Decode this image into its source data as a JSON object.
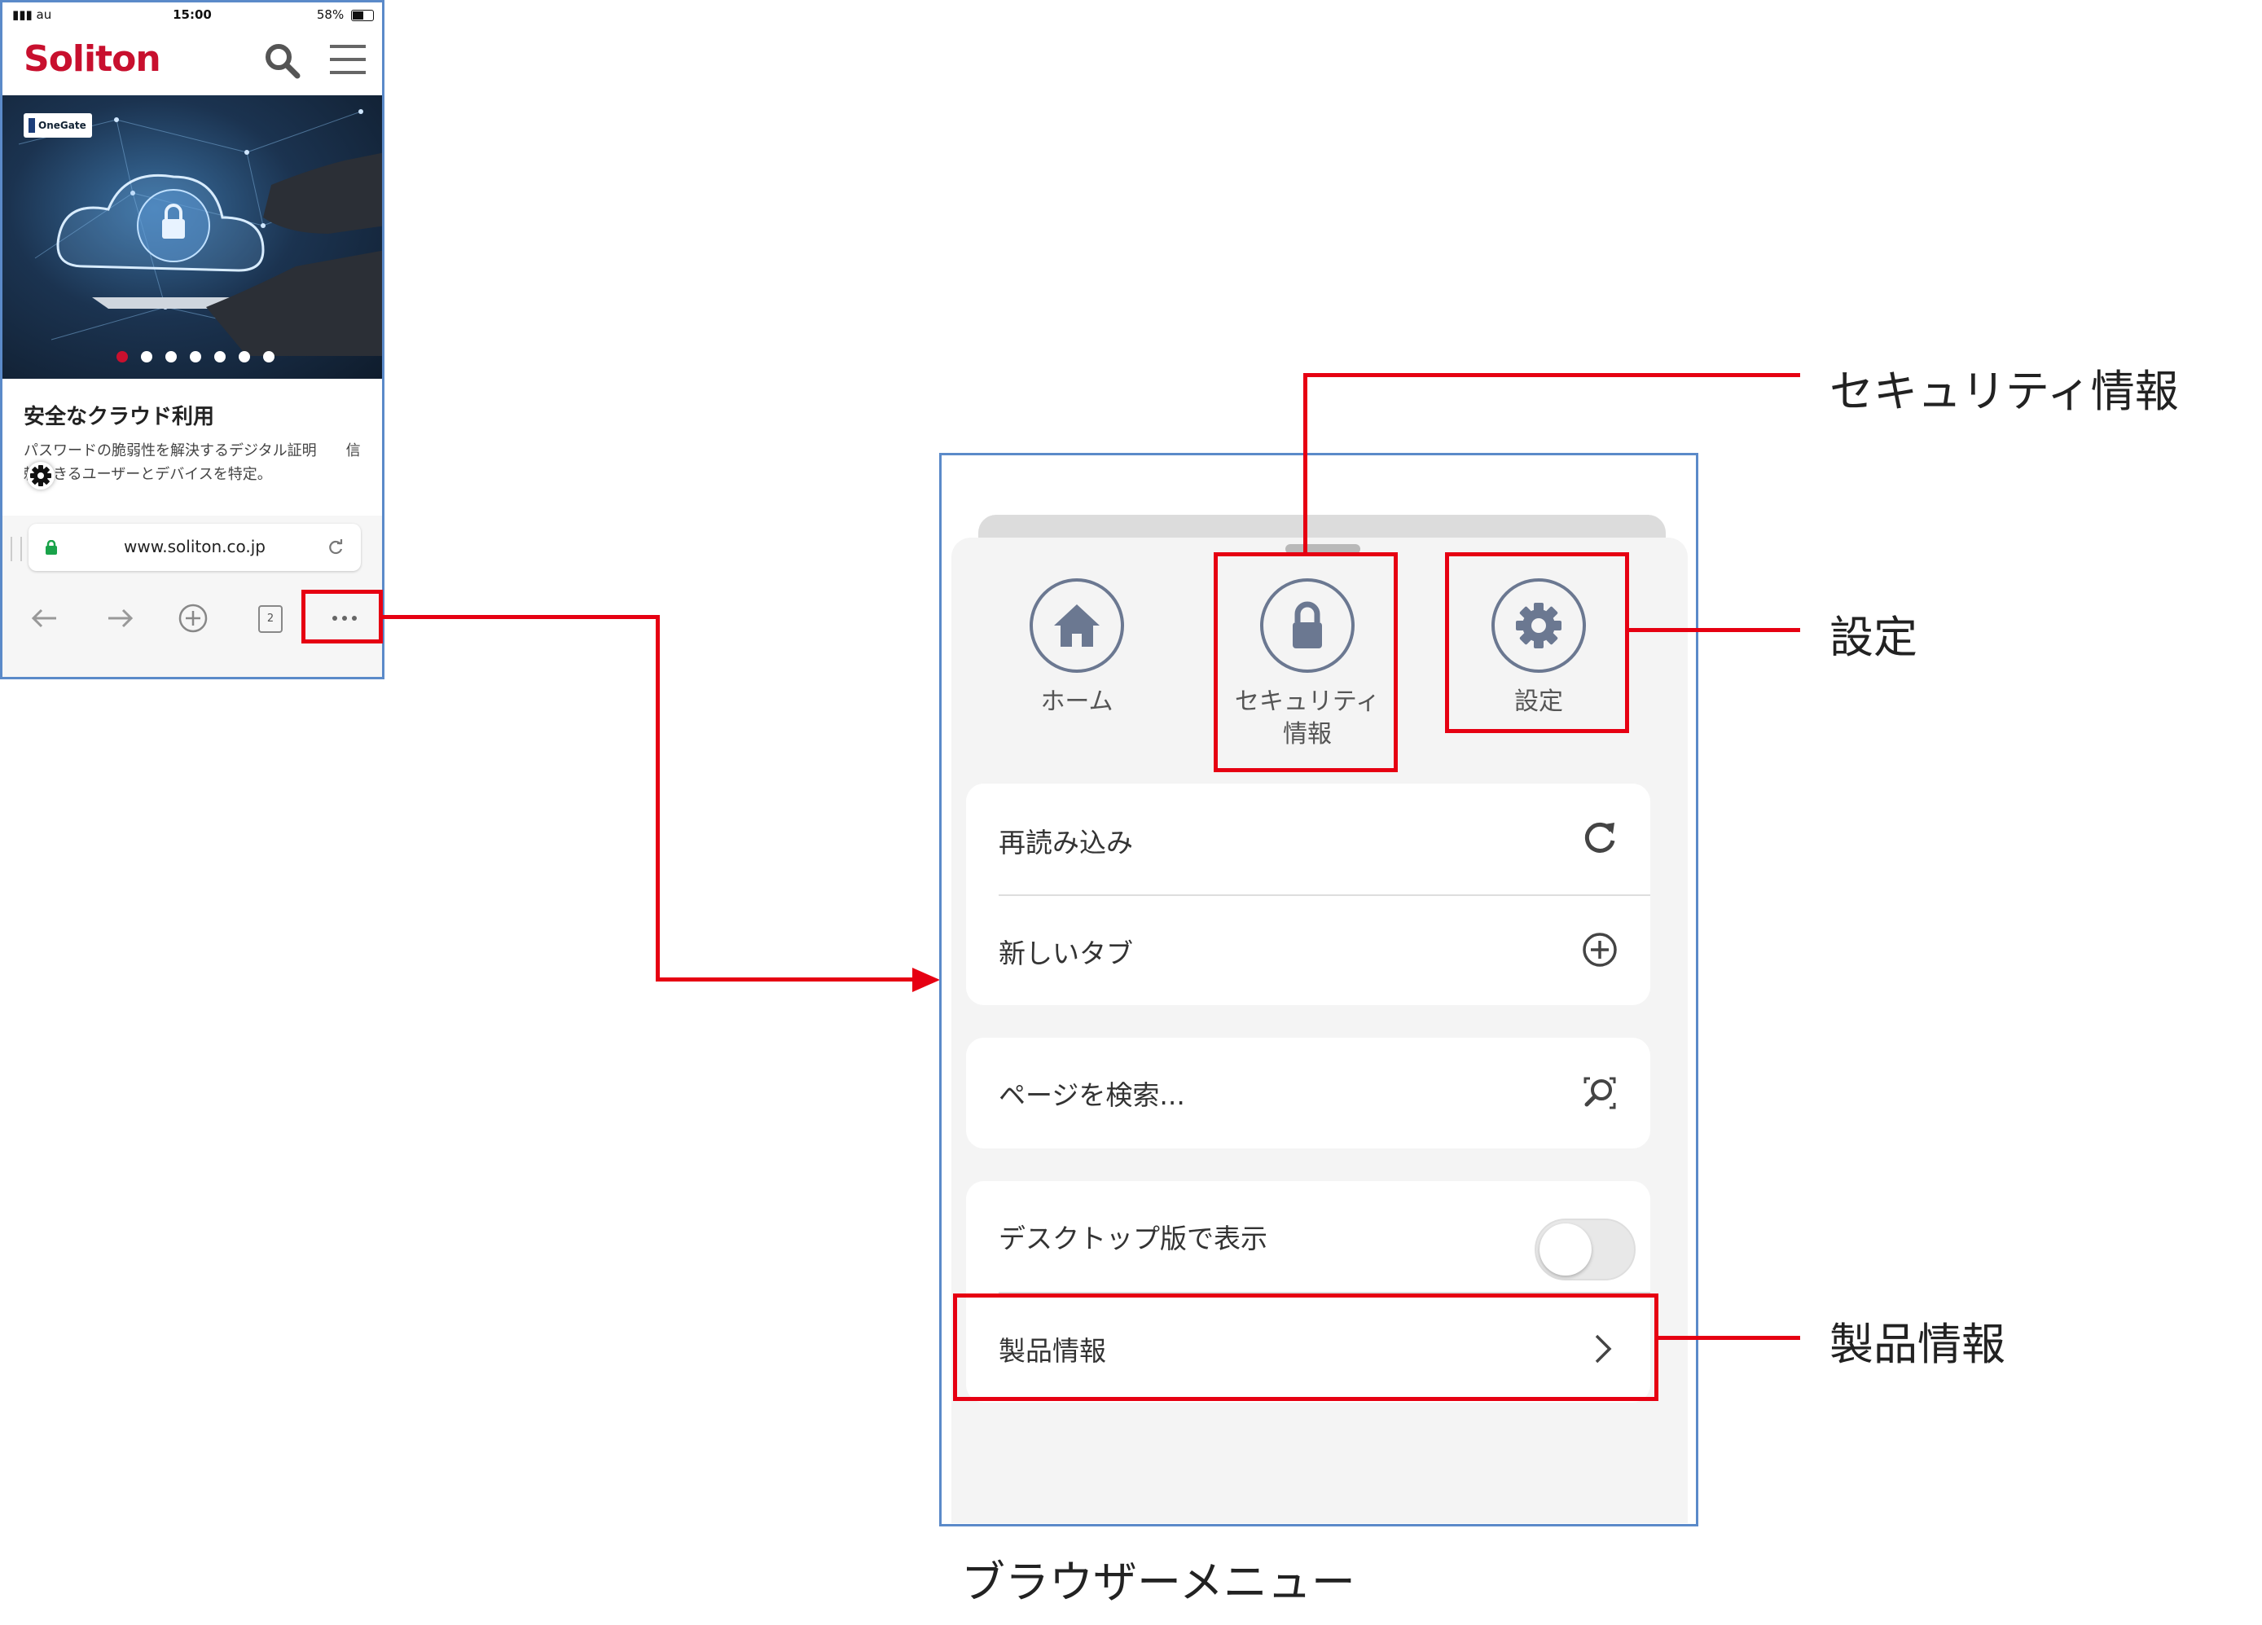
{
  "phone": {
    "status": {
      "carrier": "au",
      "time": "15:00",
      "battery": "58%"
    },
    "logo": "Soliton",
    "hero_badge": "OneGate",
    "card_title": "安全なクラウド利用",
    "card_text": "パスワードの脆弱性を解決するデジタル証明　　信頼できるユーザーとデバイスを特定。",
    "url": "www.soliton.co.jp",
    "tab_count": "2",
    "carousel_pages": 7,
    "carousel_active_index": 0
  },
  "menu": {
    "top_buttons": [
      {
        "label": "ホーム",
        "icon": "home-icon"
      },
      {
        "label": "セキュリティ\n情報",
        "icon": "lock-icon"
      },
      {
        "label": "設定",
        "icon": "gear-icon"
      }
    ],
    "rows": {
      "reload": "再読み込み",
      "new_tab": "新しいタブ",
      "find": "ページを検索...",
      "desktop": "デスクトップ版で表示",
      "product": "製品情報"
    },
    "desktop_toggle_on": false
  },
  "annotations": {
    "security": "セキュリティ情報",
    "settings": "設定",
    "product": "製品情報",
    "caption": "ブラウザーメニュー"
  },
  "colors": {
    "accent_red": "#e60012",
    "frame_blue": "#5b8ac9",
    "icon_gray": "#6b7891",
    "brand_red": "#c8102e"
  }
}
